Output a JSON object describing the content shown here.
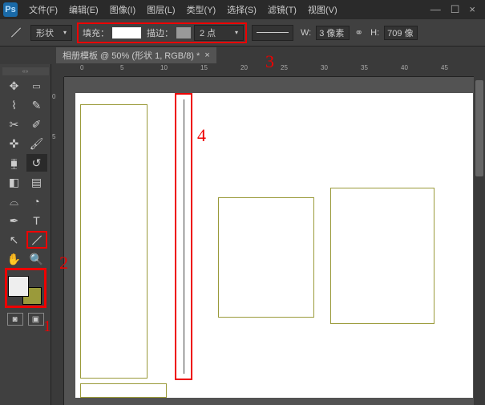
{
  "app": {
    "logo": "Ps"
  },
  "menu": {
    "file": "文件(F)",
    "edit": "编辑(E)",
    "image": "图像(I)",
    "layer": "图层(L)",
    "type": "类型(Y)",
    "select": "选择(S)",
    "filter": "滤镜(T)",
    "view": "视图(V)"
  },
  "window_controls": {
    "min": "—",
    "max": "☐",
    "close": "×"
  },
  "options": {
    "shape_mode": "形状",
    "fill_label": "填充：",
    "stroke_label": "描边：",
    "stroke_width": "2 点",
    "width_label": "W:",
    "width_value": "3 像素",
    "height_label": "H:",
    "height_value": "709 像"
  },
  "doc_tab": {
    "title": "相册模板 @ 50% (形状 1, RGB/8) *",
    "close": "×"
  },
  "rulers_top": [
    "0",
    "5",
    "10",
    "15",
    "20",
    "25",
    "30",
    "35",
    "40",
    "45"
  ],
  "rulers_left": [
    "0",
    "5"
  ],
  "annotations": {
    "a1": "1",
    "a2": "2",
    "a3": "3",
    "a4": "4"
  },
  "tools": {
    "move": "move-tool",
    "marquee": "marquee-tool",
    "lasso": "lasso-tool",
    "quick_select": "quick-select-tool",
    "crop": "crop-tool",
    "eyedropper": "eyedropper-tool",
    "healing": "healing-tool",
    "brush": "brush-tool",
    "stamp": "stamp-tool",
    "history": "history-brush-tool",
    "eraser": "eraser-tool",
    "gradient": "gradient-tool",
    "smudge": "smudge-tool",
    "dodge": "dodge-tool",
    "pen": "pen-tool",
    "type": "type-tool",
    "path": "path-select-tool",
    "line": "line-tool",
    "hand": "hand-tool",
    "zoom": "zoom-tool"
  }
}
